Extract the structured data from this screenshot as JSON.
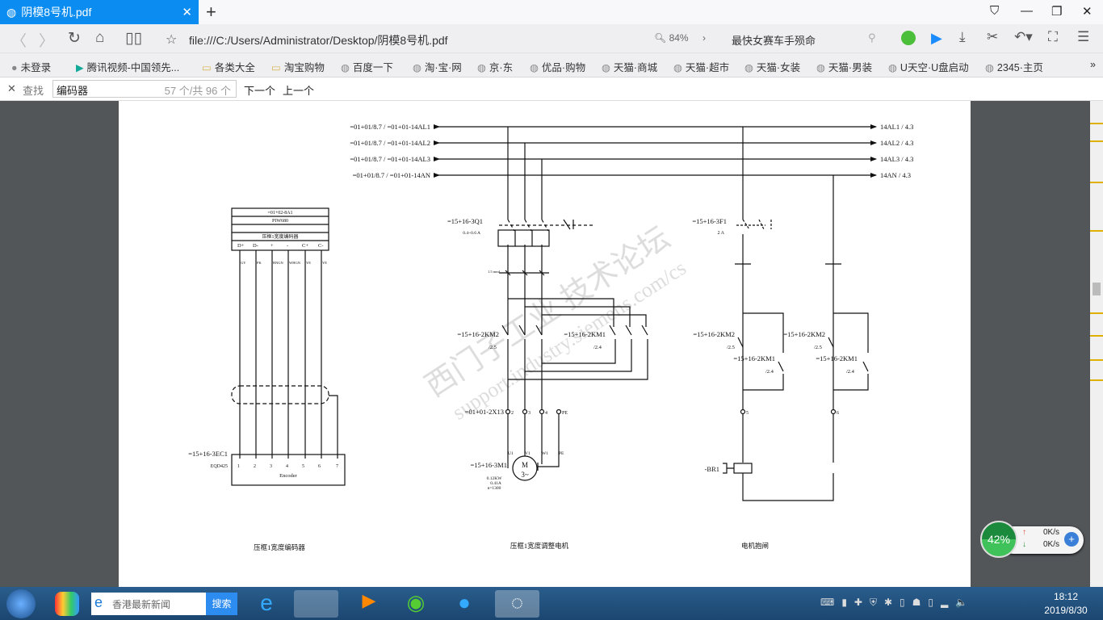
{
  "browser": {
    "tab_title": "阴模8号机.pdf",
    "url": "file:///C:/Users/Administrator/Desktop/阴模8号机.pdf",
    "zoom": "84%",
    "search_suggestion": "最快女赛车手殒命"
  },
  "bookmarks": [
    "未登录",
    "腾讯视频-中国领先...",
    "各类大全",
    "淘宝购物",
    "百度一下",
    "淘·宝·网",
    "京·东",
    "优品·购物",
    "天猫·商城",
    "天猫·超市",
    "天猫·女装",
    "天猫·男装",
    "U天空·U盘启动",
    "2345·主页"
  ],
  "find": {
    "label": "查找",
    "value": "编码器",
    "count": "57 个/共 96 个",
    "next": "下一个",
    "prev": "上一个"
  },
  "diagram": {
    "bus_left": [
      "=01+01/8.7 / =01+01-14AL1",
      "=01+01/8.7 / =01+01-14AL2",
      "=01+01/8.7 / =01+01-14AL3",
      "=01+01/8.7 / =01+01-14AN"
    ],
    "bus_right": [
      "14AL1 / 4.3",
      "14AL2 / 4.3",
      "14AL3 / 4.3",
      "14AN / 4.3"
    ],
    "encoder_rows": [
      "=01+02-8A1",
      "PIW680",
      "",
      "压框1宽度编码器"
    ],
    "encoder_pins": [
      "D+",
      "D-",
      "+",
      "-",
      "C+",
      "C-"
    ],
    "encoder_pin_nums": [
      "1",
      "5",
      "2",
      "3",
      "4",
      "6"
    ],
    "encoder_wires": [
      "GY",
      "PK",
      "BNGN",
      "WHGN",
      "YE",
      "YE"
    ],
    "encoder_ref": "=15+16-3EC1",
    "encoder_type": "EQD425",
    "encoder_label": "Encoder",
    "encoder_bottom_pins": [
      "1",
      "2",
      "3",
      "4",
      "5",
      "6",
      "7"
    ],
    "q1": "=15+16-3Q1",
    "q1_range": "0.4~0.6 A",
    "f1": "=15+16-3F1",
    "f1_rating": "2 A",
    "wire_size": "1.5 mm²",
    "km2": "=15+16-2KM2",
    "km2_ref": "/2.5",
    "km1": "=15+16-2KM1",
    "km1_ref": "/2.4",
    "x13": "=01+01-2X13",
    "x13_pins": [
      "2",
      "3",
      "4",
      "PE"
    ],
    "motor_ref": "=15+16-3M1",
    "motor_terms": [
      "U1",
      "V1",
      "W1",
      "PE"
    ],
    "motor_M": "M",
    "motor_3": "3~",
    "motor_specs": [
      "0.12KW",
      "0.41A",
      "n=1300"
    ],
    "brake_ref": "-BR1",
    "term5": "5",
    "term6": "6",
    "titles": [
      "压框1宽度编码器",
      "压框1宽度调整电机",
      "电机抱闸"
    ],
    "watermark": [
      "西门子工业 技术论坛",
      "support.industry.siemens.com/cs"
    ]
  },
  "widget": {
    "percent": "42%",
    "up": "0K/s",
    "down": "0K/s"
  },
  "taskbar": {
    "search_placeholder": "香港最新新闻",
    "search_btn": "搜索",
    "time": "18:12",
    "date": "2019/8/30"
  }
}
